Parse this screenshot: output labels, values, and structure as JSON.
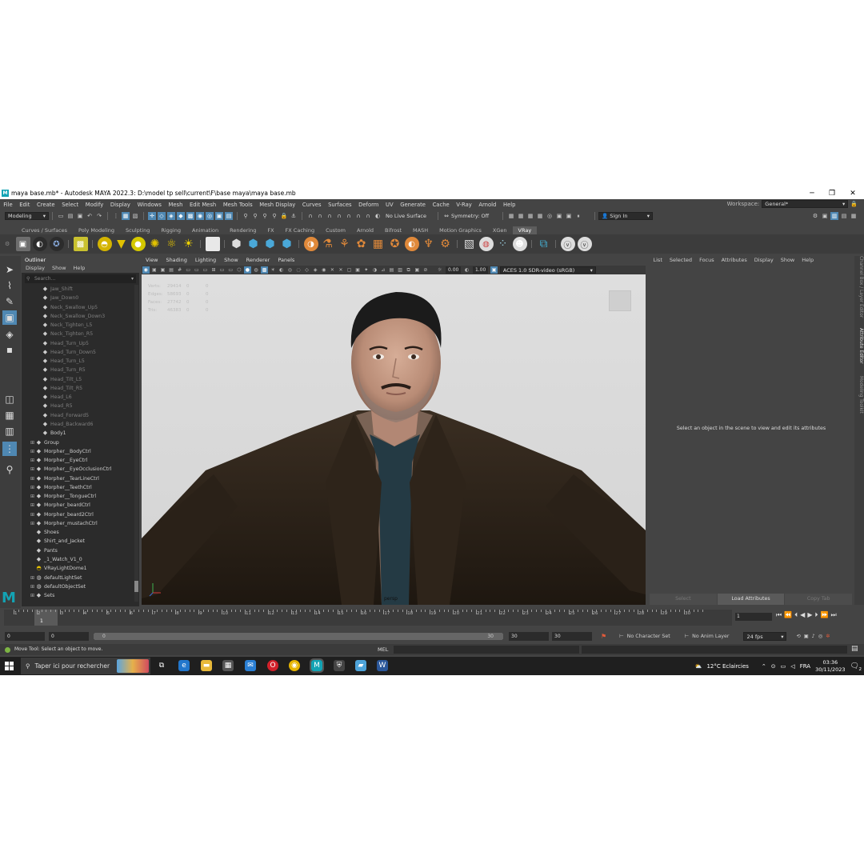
{
  "window": {
    "title": "maya base.mb* - Autodesk MAYA 2022.3: D:\\model tp sell\\current\\F\\base maya\\maya base.mb",
    "app_logo": "M"
  },
  "menu": {
    "items": [
      "File",
      "Edit",
      "Create",
      "Select",
      "Modify",
      "Display",
      "Windows",
      "Mesh",
      "Edit Mesh",
      "Mesh Tools",
      "Mesh Display",
      "Curves",
      "Surfaces",
      "Deform",
      "UV",
      "Generate",
      "Cache",
      "V-Ray",
      "Arnold",
      "Help"
    ],
    "workspace_label": "Workspace:",
    "workspace_value": "General*"
  },
  "status_line": {
    "mode": "Modeling",
    "live_surface": "No Live Surface",
    "symmetry": "Symmetry: Off",
    "sign_in": "Sign In"
  },
  "shelf": {
    "tabs": [
      "Curves / Surfaces",
      "Poly Modeling",
      "Sculpting",
      "Rigging",
      "Animation",
      "Rendering",
      "FX",
      "FX Caching",
      "Custom",
      "Arnold",
      "Bifrost",
      "MASH",
      "Motion Graphics",
      "XGen",
      "VRay"
    ],
    "active_tab": "VRay"
  },
  "outliner": {
    "title": "Outliner",
    "menu": [
      "Display",
      "Show",
      "Help"
    ],
    "search_placeholder": "Search...",
    "items": [
      {
        "label": "Jaw_Shift",
        "state": "grey"
      },
      {
        "label": "Jaw_Down0",
        "state": "grey"
      },
      {
        "label": "Neck_Swallow_Up5",
        "state": "grey"
      },
      {
        "label": "Neck_Swallow_Down3",
        "state": "grey"
      },
      {
        "label": "Neck_Tighten_L5",
        "state": "grey"
      },
      {
        "label": "Neck_Tighten_R5",
        "state": "grey"
      },
      {
        "label": "Head_Turn_Up5",
        "state": "grey"
      },
      {
        "label": "Head_Turn_Down5",
        "state": "grey"
      },
      {
        "label": "Head_Turn_L5",
        "state": "grey"
      },
      {
        "label": "Head_Turn_R5",
        "state": "grey"
      },
      {
        "label": "Head_Tilt_L5",
        "state": "grey"
      },
      {
        "label": "Head_Tilt_R5",
        "state": "grey"
      },
      {
        "label": "Head_L6",
        "state": "grey"
      },
      {
        "label": "Head_R5",
        "state": "grey"
      },
      {
        "label": "Head_Forward5",
        "state": "grey"
      },
      {
        "label": "Head_Backward6",
        "state": "grey"
      },
      {
        "label": "Body1",
        "state": "mesh"
      },
      {
        "label": "Group",
        "state": "group"
      },
      {
        "label": "Morpher__BodyCtrl",
        "state": "group"
      },
      {
        "label": "Morpher__EyeCtrl",
        "state": "group"
      },
      {
        "label": "Morpher__EyeOcclusionCtrl",
        "state": "group"
      },
      {
        "label": "Morpher__TearLineCtrl",
        "state": "group"
      },
      {
        "label": "Morpher__TeethCtrl",
        "state": "group"
      },
      {
        "label": "Morpher__TongueCtrl",
        "state": "group"
      },
      {
        "label": "Morpher_beardCtrl",
        "state": "group"
      },
      {
        "label": "Morpher_beard2Ctrl",
        "state": "group"
      },
      {
        "label": "Morpher_mustachCtrl",
        "state": "group"
      },
      {
        "label": "Shoes",
        "state": "mesh"
      },
      {
        "label": "Shirt_and_Jacket",
        "state": "mesh"
      },
      {
        "label": "Pants",
        "state": "mesh"
      },
      {
        "label": "_1_Watch_V1_0",
        "state": "mesh"
      },
      {
        "label": "VRayLightDome1",
        "state": "light"
      },
      {
        "label": "defaultLightSet",
        "state": "set"
      },
      {
        "label": "defaultObjectSet",
        "state": "set"
      },
      {
        "label": "Sets",
        "state": "group"
      }
    ]
  },
  "viewport": {
    "menu": [
      "View",
      "Shading",
      "Lighting",
      "Show",
      "Renderer",
      "Panels"
    ],
    "exposure": "0.00",
    "gamma": "1.00",
    "color_space": "ACES 1.0 SDR-video (sRGB)",
    "camera_label": "persp",
    "hud": [
      {
        "label": "Verts:",
        "a": "29414",
        "b": "0",
        "c": "0"
      },
      {
        "label": "Edges:",
        "a": "58693",
        "b": "0",
        "c": "0"
      },
      {
        "label": "Faces:",
        "a": "27742",
        "b": "0",
        "c": "0"
      },
      {
        "label": "Tris:",
        "a": "46383",
        "b": "0",
        "c": "0"
      }
    ]
  },
  "attribute_editor": {
    "menu": [
      "List",
      "Selected",
      "Focus",
      "Attributes",
      "Display",
      "Show",
      "Help"
    ],
    "message": "Select an object in the scene to view and edit its attributes",
    "buttons": [
      "Select",
      "Load Attributes",
      "Copy Tab"
    ]
  },
  "side_tabs": [
    "Channel Box / Layer Editor",
    "Attribute Editor",
    "Modeling Toolkit"
  ],
  "time_slider": {
    "ticks": [
      1,
      2,
      3,
      4,
      5,
      6,
      7,
      8,
      9,
      10,
      11,
      12,
      13,
      14,
      15,
      16,
      17,
      18,
      19,
      20,
      21,
      22,
      23,
      24,
      25,
      26,
      27,
      28,
      29,
      30
    ],
    "current_frame": "1",
    "current_frame_field": "1"
  },
  "range": {
    "start": "0",
    "anim_start": "0",
    "slider_start": "0",
    "slider_end": "30",
    "end": "30",
    "anim_end": "30",
    "character_set": "No Character Set",
    "anim_layer": "No Anim Layer",
    "fps": "24 fps"
  },
  "help_line": {
    "text": "Move Tool: Select an object to move.",
    "mel_label": "MEL"
  },
  "taskbar": {
    "search_placeholder": "Taper ici pour rechercher",
    "weather": "12°C  Eclaircies",
    "lang": "FRA",
    "time": "03:36",
    "date": "30/11/2023",
    "notif_count": "2"
  }
}
